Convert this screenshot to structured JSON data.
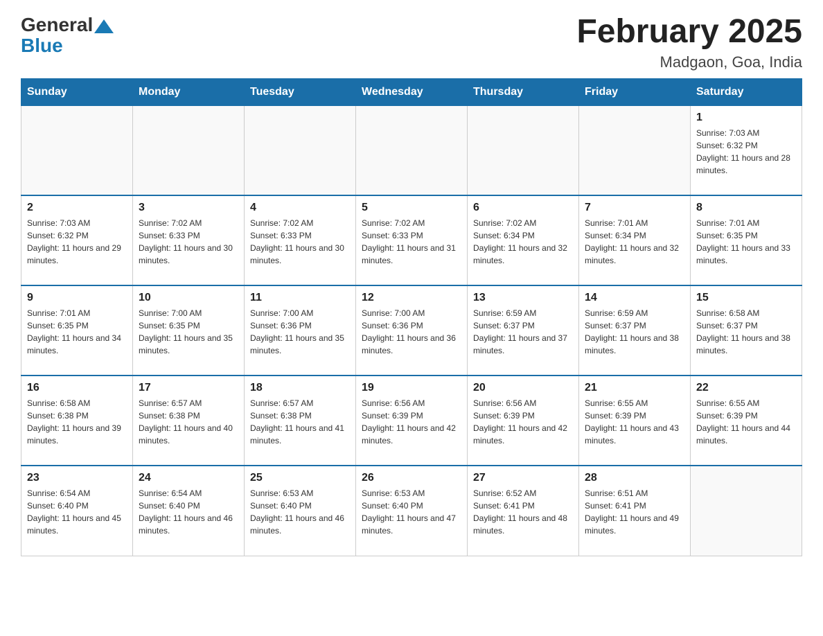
{
  "header": {
    "logo_general": "General",
    "logo_blue": "Blue",
    "title": "February 2025",
    "subtitle": "Madgaon, Goa, India"
  },
  "weekdays": [
    "Sunday",
    "Monday",
    "Tuesday",
    "Wednesday",
    "Thursday",
    "Friday",
    "Saturday"
  ],
  "weeks": [
    [
      {
        "day": "",
        "sunrise": "",
        "sunset": "",
        "daylight": ""
      },
      {
        "day": "",
        "sunrise": "",
        "sunset": "",
        "daylight": ""
      },
      {
        "day": "",
        "sunrise": "",
        "sunset": "",
        "daylight": ""
      },
      {
        "day": "",
        "sunrise": "",
        "sunset": "",
        "daylight": ""
      },
      {
        "day": "",
        "sunrise": "",
        "sunset": "",
        "daylight": ""
      },
      {
        "day": "",
        "sunrise": "",
        "sunset": "",
        "daylight": ""
      },
      {
        "day": "1",
        "sunrise": "Sunrise: 7:03 AM",
        "sunset": "Sunset: 6:32 PM",
        "daylight": "Daylight: 11 hours and 28 minutes."
      }
    ],
    [
      {
        "day": "2",
        "sunrise": "Sunrise: 7:03 AM",
        "sunset": "Sunset: 6:32 PM",
        "daylight": "Daylight: 11 hours and 29 minutes."
      },
      {
        "day": "3",
        "sunrise": "Sunrise: 7:02 AM",
        "sunset": "Sunset: 6:33 PM",
        "daylight": "Daylight: 11 hours and 30 minutes."
      },
      {
        "day": "4",
        "sunrise": "Sunrise: 7:02 AM",
        "sunset": "Sunset: 6:33 PM",
        "daylight": "Daylight: 11 hours and 30 minutes."
      },
      {
        "day": "5",
        "sunrise": "Sunrise: 7:02 AM",
        "sunset": "Sunset: 6:33 PM",
        "daylight": "Daylight: 11 hours and 31 minutes."
      },
      {
        "day": "6",
        "sunrise": "Sunrise: 7:02 AM",
        "sunset": "Sunset: 6:34 PM",
        "daylight": "Daylight: 11 hours and 32 minutes."
      },
      {
        "day": "7",
        "sunrise": "Sunrise: 7:01 AM",
        "sunset": "Sunset: 6:34 PM",
        "daylight": "Daylight: 11 hours and 32 minutes."
      },
      {
        "day": "8",
        "sunrise": "Sunrise: 7:01 AM",
        "sunset": "Sunset: 6:35 PM",
        "daylight": "Daylight: 11 hours and 33 minutes."
      }
    ],
    [
      {
        "day": "9",
        "sunrise": "Sunrise: 7:01 AM",
        "sunset": "Sunset: 6:35 PM",
        "daylight": "Daylight: 11 hours and 34 minutes."
      },
      {
        "day": "10",
        "sunrise": "Sunrise: 7:00 AM",
        "sunset": "Sunset: 6:35 PM",
        "daylight": "Daylight: 11 hours and 35 minutes."
      },
      {
        "day": "11",
        "sunrise": "Sunrise: 7:00 AM",
        "sunset": "Sunset: 6:36 PM",
        "daylight": "Daylight: 11 hours and 35 minutes."
      },
      {
        "day": "12",
        "sunrise": "Sunrise: 7:00 AM",
        "sunset": "Sunset: 6:36 PM",
        "daylight": "Daylight: 11 hours and 36 minutes."
      },
      {
        "day": "13",
        "sunrise": "Sunrise: 6:59 AM",
        "sunset": "Sunset: 6:37 PM",
        "daylight": "Daylight: 11 hours and 37 minutes."
      },
      {
        "day": "14",
        "sunrise": "Sunrise: 6:59 AM",
        "sunset": "Sunset: 6:37 PM",
        "daylight": "Daylight: 11 hours and 38 minutes."
      },
      {
        "day": "15",
        "sunrise": "Sunrise: 6:58 AM",
        "sunset": "Sunset: 6:37 PM",
        "daylight": "Daylight: 11 hours and 38 minutes."
      }
    ],
    [
      {
        "day": "16",
        "sunrise": "Sunrise: 6:58 AM",
        "sunset": "Sunset: 6:38 PM",
        "daylight": "Daylight: 11 hours and 39 minutes."
      },
      {
        "day": "17",
        "sunrise": "Sunrise: 6:57 AM",
        "sunset": "Sunset: 6:38 PM",
        "daylight": "Daylight: 11 hours and 40 minutes."
      },
      {
        "day": "18",
        "sunrise": "Sunrise: 6:57 AM",
        "sunset": "Sunset: 6:38 PM",
        "daylight": "Daylight: 11 hours and 41 minutes."
      },
      {
        "day": "19",
        "sunrise": "Sunrise: 6:56 AM",
        "sunset": "Sunset: 6:39 PM",
        "daylight": "Daylight: 11 hours and 42 minutes."
      },
      {
        "day": "20",
        "sunrise": "Sunrise: 6:56 AM",
        "sunset": "Sunset: 6:39 PM",
        "daylight": "Daylight: 11 hours and 42 minutes."
      },
      {
        "day": "21",
        "sunrise": "Sunrise: 6:55 AM",
        "sunset": "Sunset: 6:39 PM",
        "daylight": "Daylight: 11 hours and 43 minutes."
      },
      {
        "day": "22",
        "sunrise": "Sunrise: 6:55 AM",
        "sunset": "Sunset: 6:39 PM",
        "daylight": "Daylight: 11 hours and 44 minutes."
      }
    ],
    [
      {
        "day": "23",
        "sunrise": "Sunrise: 6:54 AM",
        "sunset": "Sunset: 6:40 PM",
        "daylight": "Daylight: 11 hours and 45 minutes."
      },
      {
        "day": "24",
        "sunrise": "Sunrise: 6:54 AM",
        "sunset": "Sunset: 6:40 PM",
        "daylight": "Daylight: 11 hours and 46 minutes."
      },
      {
        "day": "25",
        "sunrise": "Sunrise: 6:53 AM",
        "sunset": "Sunset: 6:40 PM",
        "daylight": "Daylight: 11 hours and 46 minutes."
      },
      {
        "day": "26",
        "sunrise": "Sunrise: 6:53 AM",
        "sunset": "Sunset: 6:40 PM",
        "daylight": "Daylight: 11 hours and 47 minutes."
      },
      {
        "day": "27",
        "sunrise": "Sunrise: 6:52 AM",
        "sunset": "Sunset: 6:41 PM",
        "daylight": "Daylight: 11 hours and 48 minutes."
      },
      {
        "day": "28",
        "sunrise": "Sunrise: 6:51 AM",
        "sunset": "Sunset: 6:41 PM",
        "daylight": "Daylight: 11 hours and 49 minutes."
      },
      {
        "day": "",
        "sunrise": "",
        "sunset": "",
        "daylight": ""
      }
    ]
  ]
}
